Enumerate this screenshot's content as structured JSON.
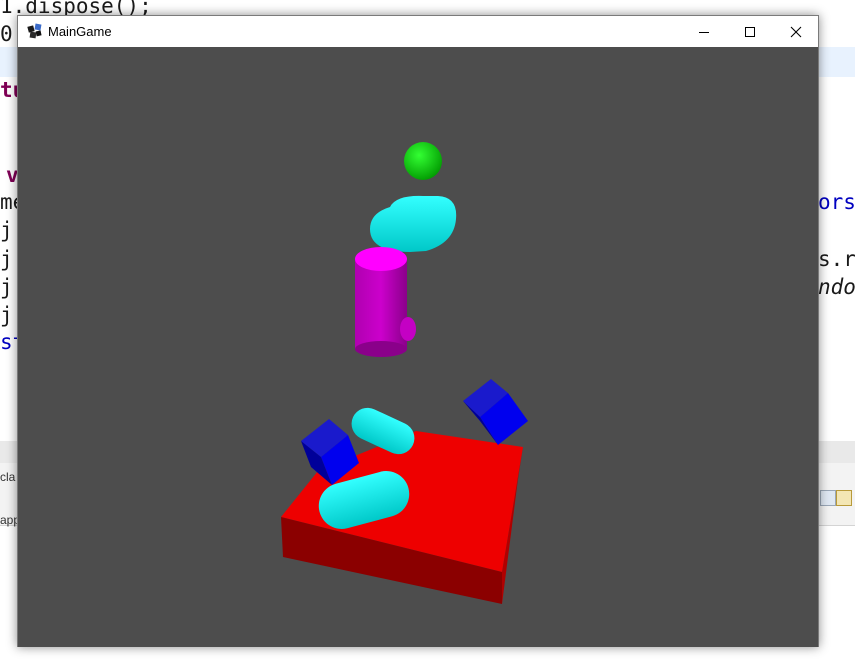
{
  "editor": {
    "lines": [
      {
        "text": "1.dispose();",
        "style": "dark"
      },
      {
        "text": "0.",
        "style": "dark"
      },
      {
        "text": "tu",
        "style": "purple"
      },
      {
        "text": "v",
        "style": "purple"
      },
      {
        "text": "me",
        "style": "dark"
      },
      {
        "text": "j.",
        "style": "dark"
      },
      {
        "text": "j.",
        "style": "dark"
      },
      {
        "text": "j.",
        "style": "dark"
      },
      {
        "text": "j.",
        "style": "dark"
      },
      {
        "text": "st",
        "style": "blue"
      }
    ],
    "right_fragments": [
      {
        "text": "ors",
        "style": "blue"
      },
      {
        "text": "s.r",
        "style": "dark"
      },
      {
        "text": "ndo",
        "style": "italic"
      }
    ]
  },
  "bottom_panel": {
    "label_1": "cla",
    "label_2": "app"
  },
  "window": {
    "title": "MainGame",
    "controls": {
      "minimize": "minimize-icon",
      "maximize": "maximize-icon",
      "close": "close-icon"
    }
  },
  "scene": {
    "background": "#4d4d4d",
    "objects": [
      {
        "kind": "sphere",
        "color": "#00cc00"
      },
      {
        "kind": "capsule",
        "color": "#00e5e5"
      },
      {
        "kind": "cylinder",
        "color": "#e600e6"
      },
      {
        "kind": "capsule",
        "color": "#00e5e5"
      },
      {
        "kind": "box",
        "color": "#0000e0"
      },
      {
        "kind": "box",
        "color": "#0000e0"
      },
      {
        "kind": "capsule",
        "color": "#00e5e5"
      },
      {
        "kind": "box",
        "color": "#e60000"
      }
    ]
  }
}
